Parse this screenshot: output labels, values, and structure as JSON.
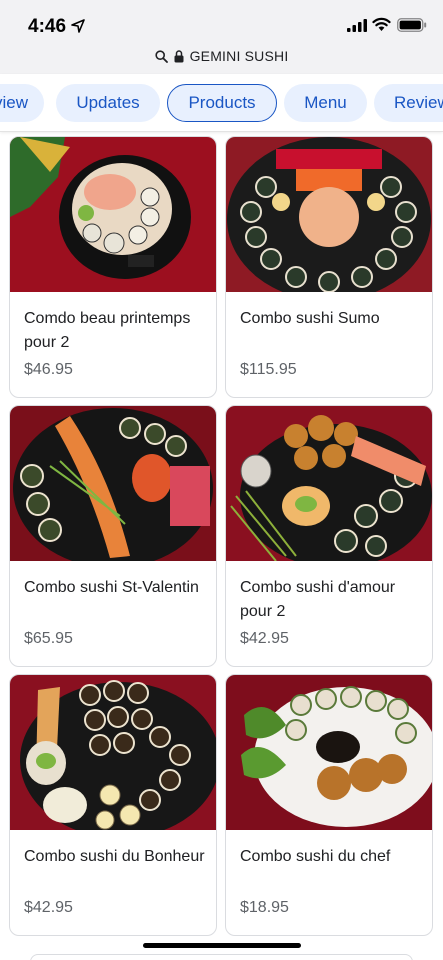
{
  "status_bar": {
    "time": "4:46"
  },
  "url_bar": {
    "site": "GEMINI SUSHI"
  },
  "tabs": [
    {
      "label": "Overview"
    },
    {
      "label": "Updates"
    },
    {
      "label": "Products"
    },
    {
      "label": "Menu"
    },
    {
      "label": "Reviews"
    }
  ],
  "tabs_visible": {
    "overview_fragment": "view",
    "reviews_fragment": "Review"
  },
  "active_tab": "Products",
  "products": [
    {
      "name": "Comdo beau printemps pour 2",
      "price": "$46.95"
    },
    {
      "name": "Combo sushi Sumo",
      "price": "$115.95"
    },
    {
      "name": "Combo sushi St-Valentin",
      "price": "$65.95"
    },
    {
      "name": "Combo sushi d'amour pour 2",
      "price": "$42.95"
    },
    {
      "name": "Combo sushi du Bonheur",
      "price": "$42.95"
    },
    {
      "name": "Combo sushi du chef",
      "price": "$18.95"
    }
  ],
  "colors": {
    "accent": "#1a56c4",
    "tab_bg": "#e8f0fe",
    "price_text": "#5f6368",
    "photo_bg": "#9c0f1f"
  }
}
